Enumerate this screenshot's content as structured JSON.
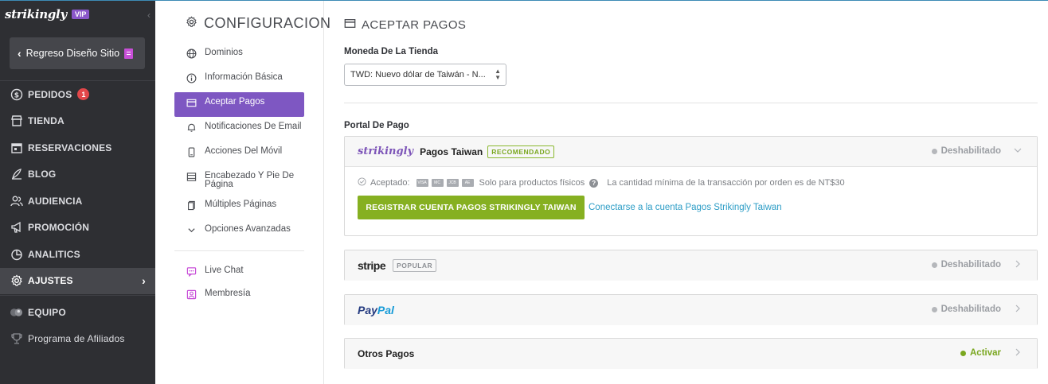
{
  "sidebar": {
    "logo": "strikingly",
    "vip_badge": "VIP",
    "back_button": "Regreso Diseño Sitio",
    "nav": [
      {
        "label": "PEDIDOS",
        "icon": "dollar-circle-icon",
        "badge": "1"
      },
      {
        "label": "TIENDA",
        "icon": "store-icon"
      },
      {
        "label": "RESERVACIONES",
        "icon": "calendar-icon"
      },
      {
        "label": "BLOG",
        "icon": "pen-icon"
      },
      {
        "label": "AUDIENCIA",
        "icon": "users-icon"
      },
      {
        "label": "PROMOCIÓN",
        "icon": "megaphone-icon"
      },
      {
        "label": "ANALITICS",
        "icon": "pie-chart-icon"
      },
      {
        "label": "AJUSTES",
        "icon": "gear-icon",
        "active": true
      }
    ],
    "team": "EQUIPO",
    "affiliates": "Programa de Afiliados"
  },
  "settings": {
    "title": "CONFIGURACION",
    "menu": [
      {
        "label": "Dominios",
        "icon": "globe-icon"
      },
      {
        "label": "Información Básica",
        "icon": "info-icon"
      },
      {
        "label": "Aceptar Pagos",
        "icon": "card-icon",
        "active": true
      },
      {
        "label": "Notificaciones De Email",
        "icon": "bell-icon"
      },
      {
        "label": "Acciones Del Móvil",
        "icon": "mobile-icon"
      },
      {
        "label": "Encabezado Y Pie De Página",
        "icon": "layout-icon"
      },
      {
        "label": "Múltiples Páginas",
        "icon": "pages-icon"
      },
      {
        "label": "Opciones Avanzadas",
        "icon": "chevron-down-icon"
      }
    ],
    "extras": [
      {
        "label": "Live Chat",
        "icon": "chat-icon",
        "color": "#c84fd8"
      },
      {
        "label": "Membresía",
        "icon": "member-icon",
        "color": "#c84fd8"
      }
    ]
  },
  "main": {
    "title": "ACEPTAR PAGOS",
    "currency_label": "Moneda De La Tienda",
    "currency_value": "TWD: Nuevo dólar de Taiwán - N...",
    "portal_label": "Portal De Pago",
    "strikingly": {
      "brand": "strikingly",
      "name": "Pagos Taiwan",
      "tag": "RECOMENDADO",
      "status": "Deshabilitado",
      "accepted_label": "Aceptado:",
      "cards": [
        "VISA",
        "MC",
        "JCB",
        "AE"
      ],
      "physical": "Solo para productos físicos",
      "minimum": "La cantidad mínima de la transacción por orden es de NT$30",
      "register_button": "REGISTRAR CUENTA PAGOS STRIKINGLY TAIWAN",
      "connect_link": "Conectarse a la cuenta Pagos Strikingly Taiwan"
    },
    "stripe": {
      "brand": "stripe",
      "tag": "POPULAR",
      "status": "Deshabilitado"
    },
    "paypal": {
      "brand_a": "Pay",
      "brand_b": "Pal",
      "status": "Deshabilitado"
    },
    "otros": {
      "label": "Otros Pagos",
      "status": "Activar"
    },
    "colors": {
      "accent_purple": "#7e57c2",
      "green": "#86b021",
      "link": "#2d9dc6"
    }
  }
}
